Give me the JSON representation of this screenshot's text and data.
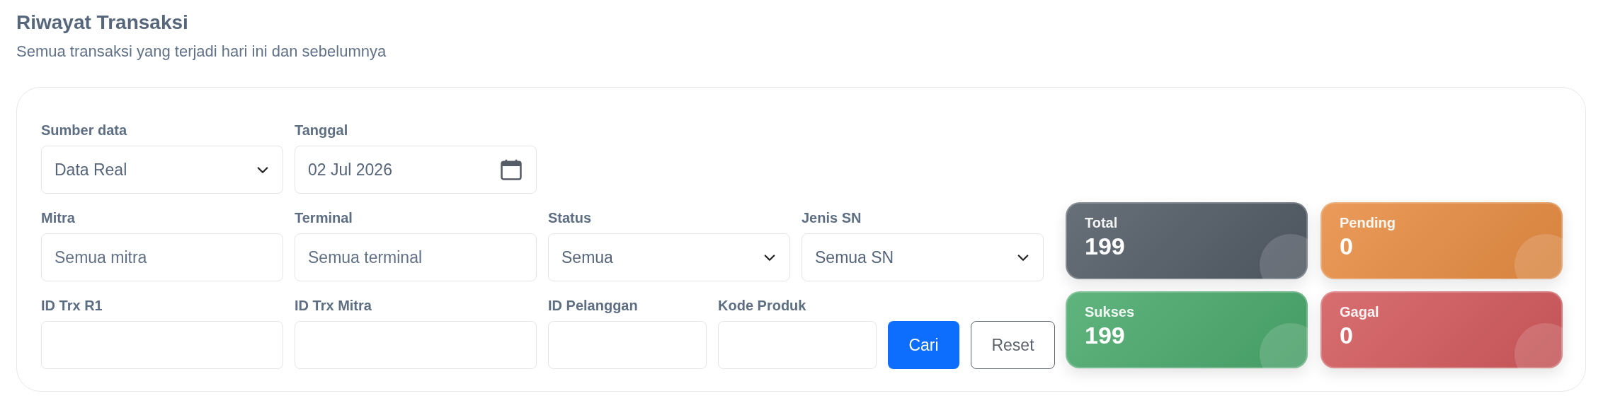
{
  "page": {
    "title": "Riwayat Transaksi",
    "subtitle": "Semua transaksi yang terjadi hari ini dan sebelumnya"
  },
  "filter_rows": [
    [
      {
        "label": "Sumber data",
        "kind": "select",
        "value": "Data Real"
      },
      {
        "label": "Tanggal",
        "kind": "date",
        "value": "02 Jul 2026"
      }
    ],
    [
      {
        "label": "Mitra",
        "kind": "text",
        "placeholder": "Semua mitra"
      },
      {
        "label": "Terminal",
        "kind": "text",
        "placeholder": "Semua terminal"
      },
      {
        "label": "Status",
        "kind": "select",
        "value": "Semua"
      },
      {
        "label": "Jenis SN",
        "kind": "select",
        "value": "Semua SN"
      }
    ],
    [
      {
        "label": "ID Trx R1",
        "kind": "text"
      },
      {
        "label": "ID Trx Mitra",
        "kind": "text"
      },
      {
        "label": "ID Pelanggan",
        "kind": "short_text"
      },
      {
        "label": "Kode Produk",
        "kind": "short_text"
      }
    ]
  ],
  "buttons": [
    {
      "label": "Cari",
      "kind": "primary"
    },
    {
      "label": "Reset",
      "kind": "outline"
    }
  ],
  "stats": [
    {
      "label": "Total",
      "value": "199",
      "color": "#525b66"
    },
    {
      "label": "Pending",
      "value": "0",
      "color": "#e88d43"
    },
    {
      "label": "Sukses",
      "value": "199",
      "color": "#4aa96c"
    },
    {
      "label": "Gagal",
      "value": "0",
      "color": "#d35a5d"
    }
  ]
}
